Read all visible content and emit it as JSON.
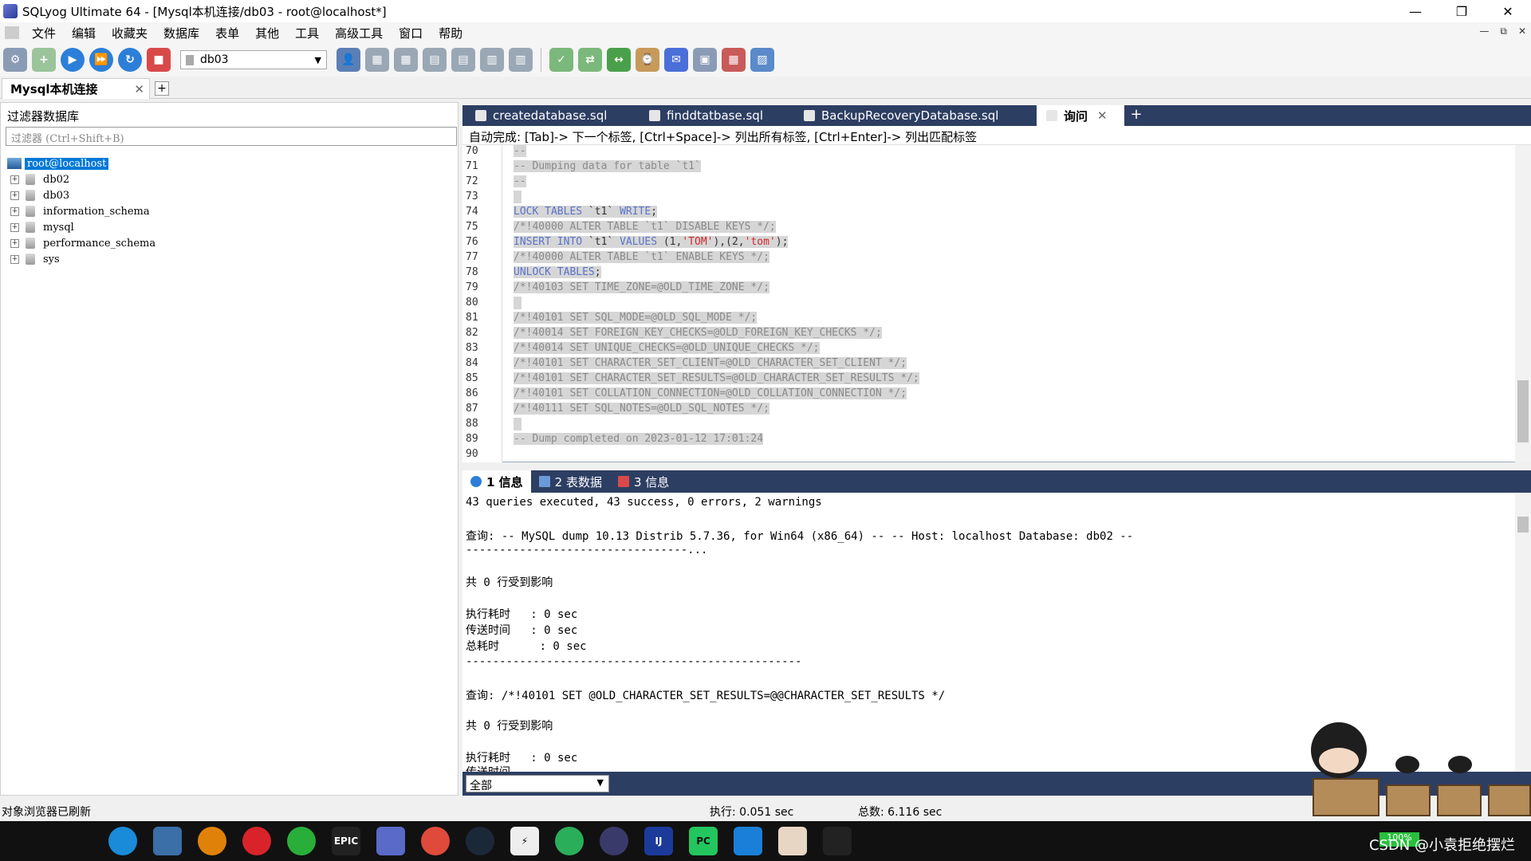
{
  "window": {
    "title": "SQLyog Ultimate 64 - [Mysql本机连接/db03 - root@localhost*]",
    "minimize": "—",
    "restore": "❐",
    "close": "✕"
  },
  "menu": [
    "文件",
    "编辑",
    "收藏夹",
    "数据库",
    "表单",
    "其他",
    "工具",
    "高级工具",
    "窗口",
    "帮助"
  ],
  "mdi_controls": {
    "minimize": "—",
    "restore": "⧉",
    "close": "✕"
  },
  "toolbar": {
    "db_value": "db03"
  },
  "connection_tab": {
    "label": "Mysql本机连接",
    "close": "✕",
    "add": "+"
  },
  "object_browser": {
    "title": "过滤器数据库",
    "filter_placeholder": "过滤器 (Ctrl+Shift+B)",
    "root": "root@localhost",
    "databases": [
      "db02",
      "db03",
      "information_schema",
      "mysql",
      "performance_schema",
      "sys"
    ]
  },
  "editor_tabs": [
    {
      "label": "createdatabase.sql"
    },
    {
      "label": "finddtatbase.sql"
    },
    {
      "label": "BackupRecoveryDatabase.sql"
    },
    {
      "label": "询问",
      "close": "✕"
    }
  ],
  "editor_add": "+",
  "autocomplete_hint": "自动完成: [Tab]-> 下一个标签, [Ctrl+Space]-> 列出所有标签, [Ctrl+Enter]-> 列出匹配标签",
  "code": {
    "line_numbers": [
      "70",
      "71",
      "72",
      "73",
      "74",
      "75",
      "76",
      "77",
      "78",
      "79",
      "80",
      "81",
      "82",
      "83",
      "84",
      "85",
      "86",
      "87",
      "88",
      "89",
      "90"
    ],
    "l70": "--",
    "l71": "-- Dumping data for table `t1`",
    "l72": "--",
    "l74a": "LOCK TABLES",
    "l74b": " `t1` ",
    "l74c": "WRITE",
    "l74d": ";",
    "l75": "/*!40000 ALTER TABLE `t1` DISABLE KEYS */;",
    "l76a": "INSERT INTO",
    "l76b": " `t1` ",
    "l76c": "VALUES",
    "l76d": " (1,",
    "l76e": "'TOM'",
    "l76f": "),(2,",
    "l76g": "'tom'",
    "l76h": ");",
    "l77": "/*!40000 ALTER TABLE `t1` ENABLE KEYS */;",
    "l78a": "UNLOCK TABLES",
    "l78b": ";",
    "l79": "/*!40103 SET TIME_ZONE=@OLD_TIME_ZONE */;",
    "l81": "/*!40101 SET SQL_MODE=@OLD_SQL_MODE */;",
    "l82": "/*!40014 SET FOREIGN_KEY_CHECKS=@OLD_FOREIGN_KEY_CHECKS */;",
    "l83": "/*!40014 SET UNIQUE_CHECKS=@OLD_UNIQUE_CHECKS */;",
    "l84": "/*!40101 SET CHARACTER_SET_CLIENT=@OLD_CHARACTER_SET_CLIENT */;",
    "l85": "/*!40101 SET CHARACTER_SET_RESULTS=@OLD_CHARACTER_SET_RESULTS */;",
    "l86": "/*!40101 SET COLLATION_CONNECTION=@OLD_COLLATION_CONNECTION */;",
    "l87": "/*!40111 SET SQL_NOTES=@OLD_SQL_NOTES */;",
    "l89": "-- Dump completed on 2023-01-12 17:01:24"
  },
  "result_tabs": [
    {
      "label": "1 信息"
    },
    {
      "label": "2 表数据"
    },
    {
      "label": "3 信息"
    }
  ],
  "results": {
    "summary": "43 queries executed, 43 success, 0 errors, 2 warnings",
    "q1": "查询: -- MySQL dump 10.13 Distrib 5.7.36, for Win64 (x86_64) -- -- Host: localhost Database: db02 --",
    "q1b": "---------------------------------...",
    "affected1": "共 0 行受到影响",
    "exec1": "执行耗时   : 0 sec",
    "send1": "传送时间   : 0 sec",
    "total1": "总耗时      : 0 sec",
    "divider": "--------------------------------------------------",
    "q2": "查询: /*!40101 SET @OLD_CHARACTER_SET_RESULTS=@@CHARACTER_SET_RESULTS */",
    "affected2": "共 0 行受到影响",
    "exec2": "执行耗时   : 0 sec",
    "send2": "传送时间"
  },
  "result_filter": "全部",
  "status": {
    "left": "对象浏览器已刷新",
    "exec": "执行: 0.051 sec",
    "total": "总数: 6.116 sec"
  },
  "taskbar": {
    "watermark": "CSDN @小袁拒绝摆烂",
    "battery": "100%"
  },
  "colors": {
    "tab_bar": "#2d3e63",
    "selection": "#0078d7",
    "comment": "#8a8a8a",
    "keyword": "#5b73c9",
    "string": "#d0272e"
  }
}
